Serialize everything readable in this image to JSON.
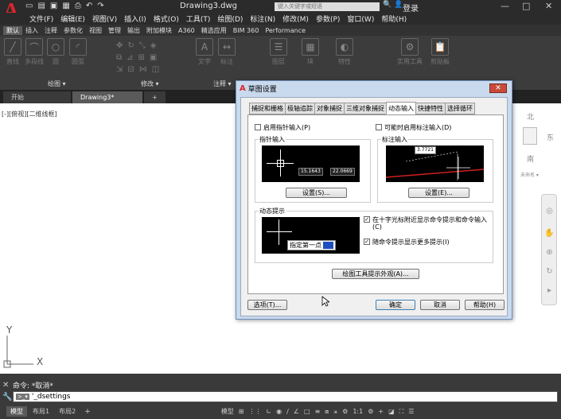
{
  "titlebar": {
    "title": "Drawing3.dwg",
    "search_placeholder": "键入关键字或短语",
    "login": "登录",
    "win_buttons": [
      "—",
      "□",
      "✕"
    ]
  },
  "menubar": [
    "文件(F)",
    "编辑(E)",
    "视图(V)",
    "插入(I)",
    "格式(O)",
    "工具(T)",
    "绘图(D)",
    "标注(N)",
    "修改(M)",
    "参数(P)",
    "窗口(W)",
    "帮助(H)"
  ],
  "ribbon_tabs": [
    "默认",
    "插入",
    "注释",
    "参数化",
    "视图",
    "管理",
    "输出",
    "附加模块",
    "A360",
    "精选应用",
    "BIM 360",
    "Performance"
  ],
  "ribbon": {
    "buttons": [
      "直线",
      "多段线",
      "圆",
      "圆弧",
      "文字",
      "标注",
      "图层",
      "块",
      "特性",
      "实用工具",
      "剪贴板"
    ],
    "panels": [
      "绘图 ▾",
      "修改 ▾",
      "注释 ▾"
    ]
  },
  "file_tabs": [
    "开始",
    "Drawing3*",
    "+"
  ],
  "viewport_label": "[-][俯视][二维线框]",
  "compass": {
    "n": "北",
    "e": "东",
    "s": "南",
    "ucs": "未命名 ▾"
  },
  "dialog": {
    "title": "草图设置",
    "close": "✕",
    "tabs": [
      "捕捉和栅格",
      "极轴追踪",
      "对象捕捉",
      "三维对象捕捉",
      "动态输入",
      "快捷特性",
      "选择循环"
    ],
    "active_tab": "动态输入",
    "pointer_input_enable": "启用指针输入(P)",
    "dimension_input_enable": "可能时启用标注输入(D)",
    "pointer_group": "指针输入",
    "dimension_group": "标注输入",
    "pointer_values": [
      "15.1643",
      "22.0669"
    ],
    "dimension_value": "3.7721",
    "settings_button_1": "设置(S)...",
    "settings_button_2": "设置(E)...",
    "dynamic_prompt_group": "动态提示",
    "prompt_text": "指定第一点",
    "option_near_crosshair": "在十字光标附近显示命令提示和命令输入(C)",
    "option_more_prompts": "随命令提示显示更多提示(I)",
    "drafting_tooltip_button": "绘图工具提示外观(A)...",
    "options_button": "选项(T)...",
    "ok_button": "确定",
    "cancel_button": "取消",
    "help_button": "帮助(H)"
  },
  "command": {
    "history": "命令: *取消*",
    "input": "'_dsettings"
  },
  "layout_tabs": [
    "模型",
    "布局1",
    "布局2",
    "+"
  ],
  "status": {
    "model": "模型",
    "scale": "1:1"
  },
  "axes": {
    "x": "X",
    "y": "Y"
  }
}
